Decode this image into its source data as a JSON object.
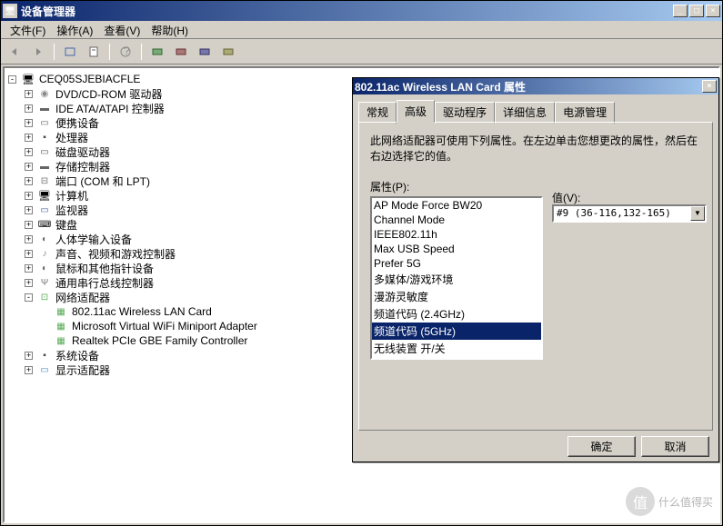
{
  "window": {
    "title": "设备管理器",
    "min_tip": "_",
    "max_tip": "□",
    "close_tip": "×"
  },
  "menu": {
    "file": "文件(F)",
    "action": "操作(A)",
    "view": "查看(V)",
    "help": "帮助(H)"
  },
  "tree": {
    "root": "CEQ05SJEBIACFLE",
    "nodes": [
      {
        "label": "DVD/CD-ROM 驱动器",
        "icon": "cd"
      },
      {
        "label": "IDE ATA/ATAPI 控制器",
        "icon": "storage"
      },
      {
        "label": "便携设备",
        "icon": "device"
      },
      {
        "label": "处理器",
        "icon": "chip"
      },
      {
        "label": "磁盘驱动器",
        "icon": "disk"
      },
      {
        "label": "存储控制器",
        "icon": "storage"
      },
      {
        "label": "端口 (COM 和 LPT)",
        "icon": "port"
      },
      {
        "label": "计算机",
        "icon": "computer"
      },
      {
        "label": "监视器",
        "icon": "monitor"
      },
      {
        "label": "键盘",
        "icon": "keyboard"
      },
      {
        "label": "人体学输入设备",
        "icon": "mouse"
      },
      {
        "label": "声音、视频和游戏控制器",
        "icon": "audio"
      },
      {
        "label": "鼠标和其他指针设备",
        "icon": "mouse"
      },
      {
        "label": "通用串行总线控制器",
        "icon": "usb"
      }
    ],
    "network_node": "网络适配器",
    "network_children": [
      "802.11ac Wireless LAN Card",
      "Microsoft Virtual WiFi Miniport Adapter",
      "Realtek PCIe GBE Family Controller"
    ],
    "tail_nodes": [
      {
        "label": "系统设备",
        "icon": "chip"
      },
      {
        "label": "显示适配器",
        "icon": "display"
      }
    ]
  },
  "dialog": {
    "title": "802.11ac Wireless LAN Card 属性",
    "close": "×",
    "tabs": {
      "general": "常规",
      "advanced": "高级",
      "driver": "驱动程序",
      "details": "详细信息",
      "power": "电源管理"
    },
    "description": "此网络适配器可使用下列属性。在左边单击您想更改的属性，然后在右边选择它的值。",
    "prop_label": "属性(P):",
    "value_label": "值(V):",
    "properties": [
      "AP Mode Force BW20",
      "Channel Mode",
      "IEEE802.11h",
      "Max USB Speed",
      "Prefer 5G",
      "多媒体/游戏环境",
      "漫游灵敏度",
      "频道代码 (2.4GHz)",
      "频道代码 (5GHz)",
      "无线装置 开/关"
    ],
    "selected_property_index": 8,
    "value": "#9 (36-116,132-165)",
    "ok": "确定",
    "cancel": "取消"
  },
  "watermark": {
    "badge": "值",
    "text": "什么值得买"
  }
}
